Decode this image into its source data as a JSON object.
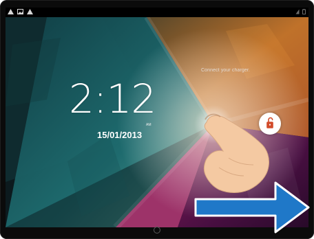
{
  "lockscreen": {
    "charger_message": "Connect your charger.",
    "time": "2:12",
    "ampm": "AM",
    "date": "15/01/2013"
  },
  "icons": {
    "status_left": [
      "warning-icon",
      "image-icon",
      "warning-icon"
    ],
    "status_right": [
      "wifi-icon",
      "battery-icon"
    ],
    "unlock": "unlock-icon",
    "hand": "hand-gesture-icon",
    "arrow": "swipe-right-arrow-icon",
    "home": "home-button-icon"
  },
  "colors": {
    "arrow_fill": "#1f78c8",
    "arrow_stroke": "#ffffff",
    "lock_icon": "#d24b2a",
    "hand": "#f4c9a2"
  }
}
